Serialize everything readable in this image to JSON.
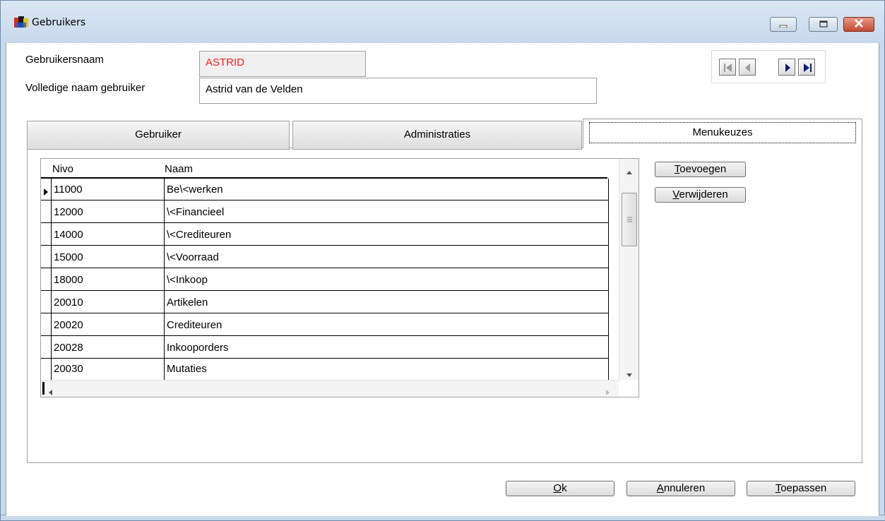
{
  "window": {
    "title": "Gebruikers",
    "icon": "app-icon"
  },
  "form": {
    "username_label": "Gebruikersnaam",
    "username_value": "ASTRID",
    "fullname_label": "Volledige naam gebruiker",
    "fullname_value": "Astrid van de Velden"
  },
  "navigation": {
    "buttons": [
      "first-record-icon",
      "previous-record-icon",
      "next-record-icon",
      "last-record-icon"
    ]
  },
  "tabs": [
    {
      "label": "Gebruiker",
      "active": false
    },
    {
      "label": "Administraties",
      "active": false
    },
    {
      "label": "Menukeuzes",
      "active": true
    }
  ],
  "grid": {
    "columns": [
      "Nivo",
      "Naam"
    ],
    "rows": [
      {
        "nivo": "11000",
        "naam": "Be\\<werken"
      },
      {
        "nivo": "12000",
        "naam": "\\<Financieel"
      },
      {
        "nivo": "14000",
        "naam": "\\<Crediteuren"
      },
      {
        "nivo": "15000",
        "naam": "\\<Voorraad"
      },
      {
        "nivo": "18000",
        "naam": "\\<Inkoop"
      },
      {
        "nivo": "20010",
        "naam": "Artikelen"
      },
      {
        "nivo": "20020",
        "naam": "Crediteuren"
      },
      {
        "nivo": "20028",
        "naam": "Inkooporders"
      },
      {
        "nivo": "20030",
        "naam": "Mutaties"
      }
    ]
  },
  "side_buttons": {
    "add_first": "T",
    "add_rest": "oevoegen",
    "remove_first": "V",
    "remove_rest": "erwijderen"
  },
  "footer_buttons": {
    "ok_first": "O",
    "ok_rest": "k",
    "cancel_first": "A",
    "cancel_rest": "nnuleren",
    "apply_first": "T",
    "apply_rest": "oepassen"
  },
  "colors": {
    "username_text": "#ff1b1b",
    "titlebar": "#c8d8ec",
    "close_button": "#c24b33"
  }
}
